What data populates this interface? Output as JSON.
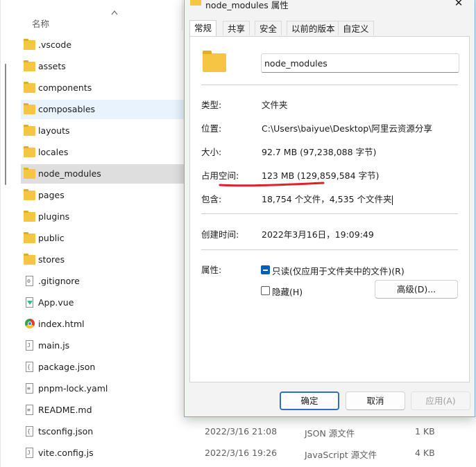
{
  "explorer": {
    "column_header": "名称",
    "files": [
      {
        "name": ".vscode",
        "icon": "folder-icon"
      },
      {
        "name": "assets",
        "icon": "folder-icon"
      },
      {
        "name": "components",
        "icon": "folder-icon"
      },
      {
        "name": "composables",
        "icon": "folder-icon"
      },
      {
        "name": "layouts",
        "icon": "folder-icon"
      },
      {
        "name": "locales",
        "icon": "folder-icon"
      },
      {
        "name": "node_modules",
        "icon": "folder-icon"
      },
      {
        "name": "pages",
        "icon": "folder-icon"
      },
      {
        "name": "plugins",
        "icon": "folder-icon"
      },
      {
        "name": "public",
        "icon": "folder-icon"
      },
      {
        "name": "stores",
        "icon": "folder-icon"
      },
      {
        "name": ".gitignore",
        "icon": "config-file-icon"
      },
      {
        "name": "App.vue",
        "icon": "vue-file-icon"
      },
      {
        "name": "index.html",
        "icon": "chrome-icon"
      },
      {
        "name": "main.js",
        "icon": "js-file-icon"
      },
      {
        "name": "package.json",
        "icon": "json-file-icon"
      },
      {
        "name": "pnpm-lock.yaml",
        "icon": "text-file-icon"
      },
      {
        "name": "README.md",
        "icon": "text-file-icon"
      },
      {
        "name": "tsconfig.json",
        "icon": "json-file-icon"
      },
      {
        "name": "vite.config.js",
        "icon": "js-file-icon"
      }
    ],
    "visible_details": [
      {
        "date": "2022/3/16 21:08",
        "type": "JSON 源文件",
        "size": "1 KB"
      },
      {
        "date": "2022/3/16 19:26",
        "type": "JavaScript 源文件",
        "size": "4 KB"
      }
    ]
  },
  "dialog": {
    "title": "node_modules 属性",
    "close_glyph": "✕",
    "tabs": [
      "常规",
      "共享",
      "安全",
      "以前的版本",
      "自定义"
    ],
    "active_tab": "常规",
    "name_value": "node_modules",
    "properties": {
      "type_label": "类型:",
      "type_value": "文件夹",
      "location_label": "位置:",
      "location_value": "C:\\Users\\baiyue\\Desktop\\阿里云资源分享",
      "size_label": "大小:",
      "size_value": "92.7 MB (97,238,088 字节)",
      "disk_label": "占用空间:",
      "disk_value": "123 MB (129,859,584 字节)",
      "contains_label": "包含:",
      "contains_value": "18,754 个文件，4,535 个文件夹",
      "created_label": "创建时间:",
      "created_value": "2022年3月16日，19:09:49",
      "attributes_label": "属性:"
    },
    "attributes": {
      "readonly_label": "只读(仅应用于文件夹中的文件)(R)",
      "readonly_checked": true,
      "hidden_label": "隐藏(H)",
      "hidden_checked": false,
      "advanced_label": "高级(D)..."
    },
    "buttons": {
      "ok": "确定",
      "cancel": "取消",
      "apply": "应用(A)"
    },
    "annotation_color": "#e0202a",
    "accent_color": "#005fb8"
  }
}
